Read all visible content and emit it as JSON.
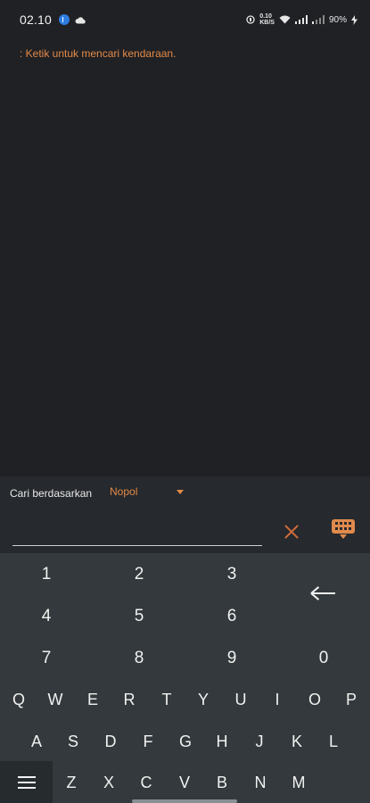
{
  "status_bar": {
    "time": "02.10",
    "speed_top": "0.10",
    "speed_bottom": "KB/S",
    "battery": "90%"
  },
  "hint": {
    "text": ": Ketik untuk mencari kendaraan."
  },
  "search": {
    "label": "Cari berdasarkan",
    "selected_filter": "Nopol",
    "input_value": "",
    "input_placeholder": ""
  },
  "keyboard": {
    "numbers": [
      "1",
      "2",
      "3",
      "4",
      "5",
      "6",
      "7",
      "8",
      "9",
      "0"
    ],
    "row_qwerty": [
      "Q",
      "W",
      "E",
      "R",
      "T",
      "Y",
      "U",
      "I",
      "O",
      "P"
    ],
    "row_asdf": [
      "A",
      "S",
      "D",
      "F",
      "G",
      "H",
      "J",
      "K",
      "L"
    ],
    "row_zxcv": [
      "Z",
      "X",
      "C",
      "V",
      "B",
      "N",
      "M"
    ]
  },
  "colors": {
    "accent": "#e48a46",
    "background": "#202125",
    "keyboard": "#33393c"
  },
  "icons": {
    "clear": "close-icon",
    "keyboard_toggle": "keyboard-icon",
    "backspace": "backspace-arrow-icon",
    "menu": "hamburger-menu-icon",
    "dropdown": "caret-down-icon"
  }
}
